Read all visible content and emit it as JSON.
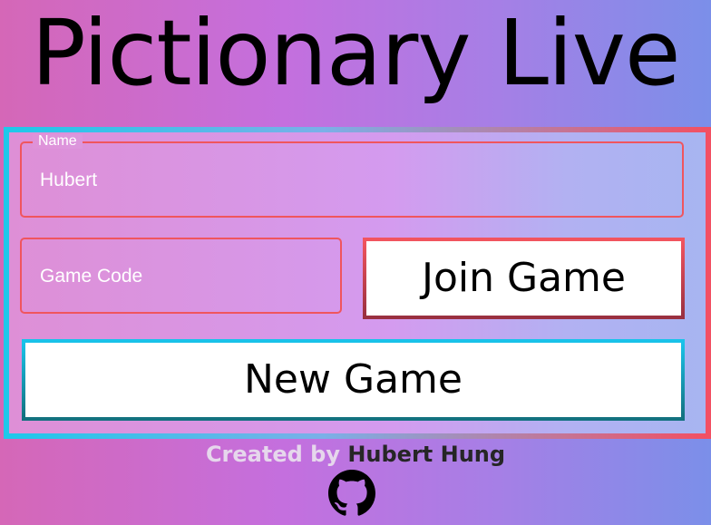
{
  "app": {
    "title": "Pictionary Live"
  },
  "form": {
    "name_legend": "Name",
    "name_value": "Hubert",
    "game_code_placeholder": "Game Code",
    "game_code_value": "",
    "join_button_label": "Join Game",
    "new_button_label": "New Game"
  },
  "footer": {
    "created_by_label": "Created by",
    "author": "Hubert Hung",
    "link_icon": "github-icon"
  },
  "colors": {
    "field_border": "#f0555e",
    "card_border_left": "#1ec8ea",
    "card_border_right": "#f25063",
    "join_border": "#f2545f",
    "new_border": "#19c3ea"
  }
}
